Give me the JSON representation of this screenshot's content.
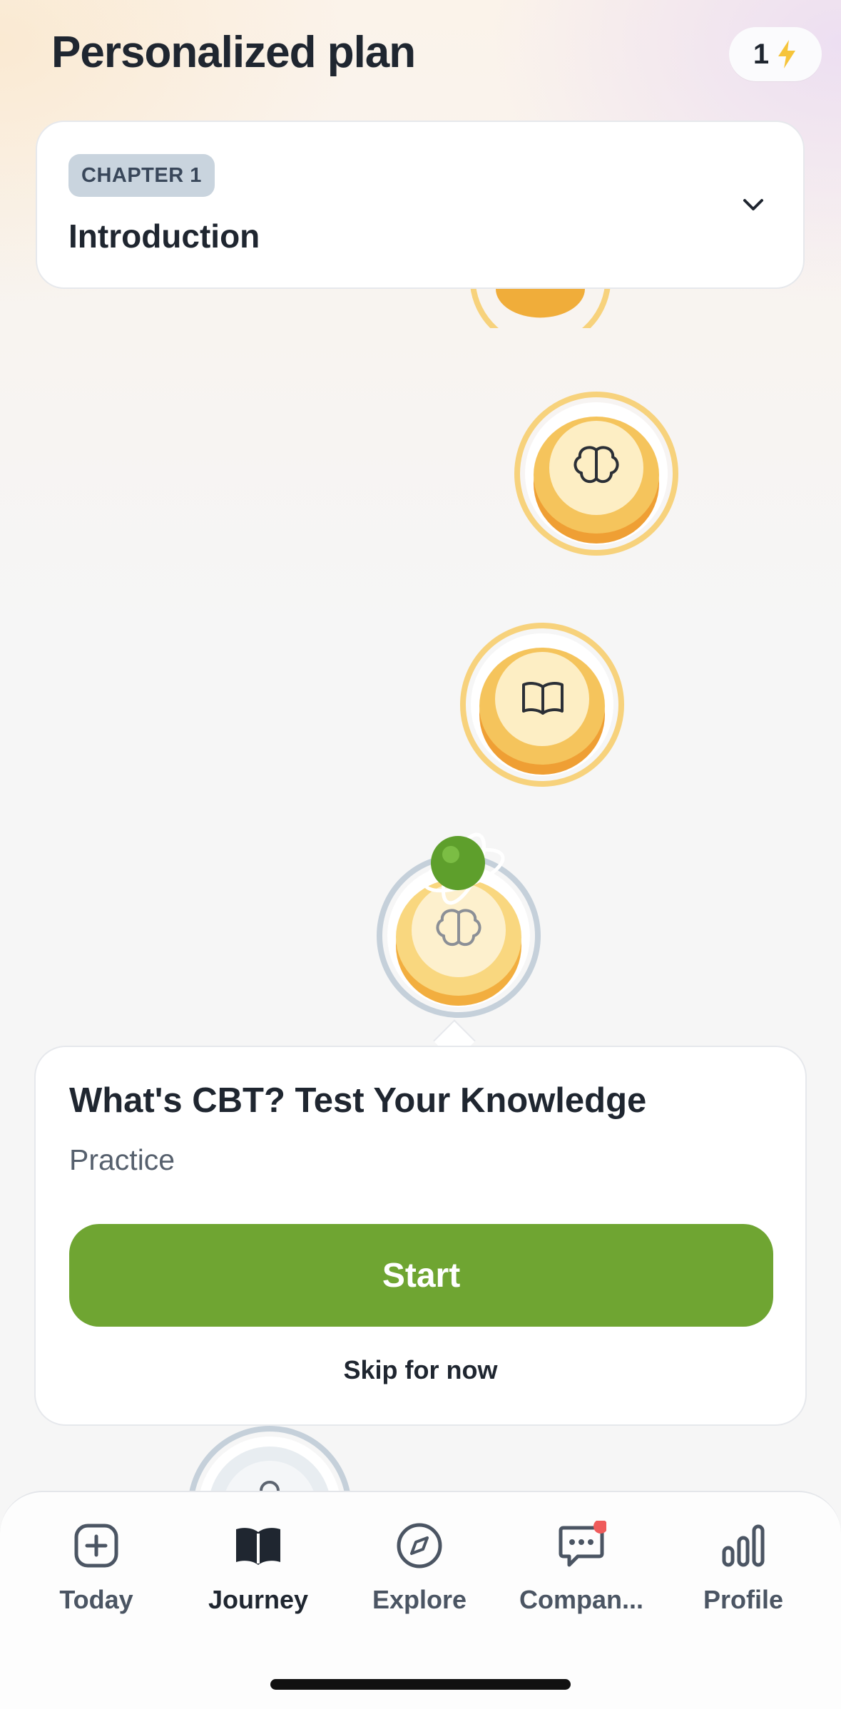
{
  "header": {
    "title": "Personalized plan",
    "streak_count": "1",
    "streak_icon": "lightning-bolt-icon"
  },
  "chapter": {
    "badge": "CHAPTER 1",
    "title": "Introduction",
    "toggle_icon": "chevron-down-icon"
  },
  "path_nodes": [
    {
      "icon": "brain-icon",
      "state": "completed"
    },
    {
      "icon": "book-open-icon",
      "state": "completed"
    },
    {
      "icon": "brain-icon",
      "state": "current"
    },
    {
      "icon": "lock-icon",
      "state": "locked"
    }
  ],
  "popup": {
    "title": "What's CBT? Test Your Knowledge",
    "subtitle": "Practice",
    "start_label": "Start",
    "skip_label": "Skip for now"
  },
  "tabs": [
    {
      "label": "Today",
      "icon": "plus-square-icon",
      "active": false
    },
    {
      "label": "Journey",
      "icon": "book-open-icon",
      "active": true
    },
    {
      "label": "Explore",
      "icon": "compass-icon",
      "active": false
    },
    {
      "label": "Compan...",
      "icon": "chat-bubble-icon",
      "active": false,
      "notification_dot": true
    },
    {
      "label": "Profile",
      "icon": "bar-chart-icon",
      "active": false
    }
  ],
  "colors": {
    "primary_green": "#6fa532",
    "node_gold": "#f5c45c",
    "node_locked_ring": "#c5d0da",
    "notification": "#ef5b5b",
    "streak_bolt": "#f6c43a"
  }
}
